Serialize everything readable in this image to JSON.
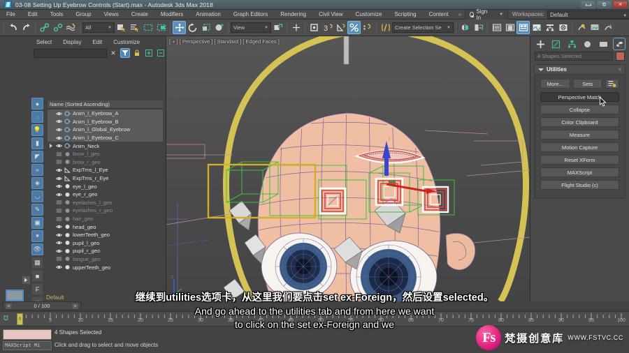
{
  "window": {
    "title": "03-08 Setting Up Eyebrow Controls (Start).max - Autodesk 3ds Max 2018",
    "app_icon": "3dsmax-icon",
    "buttons": {
      "minimize": "minimize-icon",
      "restore": "restore-icon",
      "close": "close-icon"
    }
  },
  "menubar": {
    "items": [
      "File",
      "Edit",
      "Tools",
      "Group",
      "Views",
      "Create",
      "Modifiers",
      "Animation",
      "Graph Editors",
      "Rendering",
      "Civil View",
      "Customize",
      "Scripting",
      "Content"
    ],
    "overflow": "»",
    "signin_label": "Sign In",
    "workspaces_label": "Workspaces:",
    "workspaces_value": "Default"
  },
  "toolbar": {
    "undo": "undo-icon",
    "redo": "redo-icon",
    "select_link": "select-and-link-icon",
    "unlink": "unlink-selection-icon",
    "bind_space_warp": "bind-to-space-warp-icon",
    "selection_filter": "All",
    "select_object": "select-object-icon",
    "select_by_name": "select-by-name-icon",
    "rect_select": "rectangular-selection-region-icon",
    "window_crossing": "window-crossing-icon",
    "select_move": "select-and-move-icon",
    "select_rotate": "select-and-rotate-icon",
    "select_scale": "select-and-scale-icon",
    "placement": "select-and-place-icon",
    "ref_coord_system": "View",
    "use_pivot": "use-pivot-point-center-icon",
    "select_manipulate": "select-and-manipulate-icon",
    "snaps_toggle_3": "snaps-toggle-icon",
    "angle_snap": "angle-snap-toggle-icon",
    "percent_snap": "percent-snap-toggle-icon",
    "spinner_snap": "spinner-snap-toggle-icon",
    "named_sel_edit": "edit-named-selection-sets-icon",
    "named_sel_value": "Create Selection Se",
    "mirror": "mirror-icon",
    "align": "align-icon",
    "layer_explorer": "layer-explorer-icon",
    "scene_explorer": "scene-explorer-icon",
    "ribbon_toggle": "toggle-ribbon-icon",
    "curve_editor": "curve-editor-icon",
    "schematic_view": "schematic-view-icon",
    "material_editor": "material-editor-icon",
    "render_setup": "render-setup-icon",
    "rendered_frame": "rendered-frame-window-icon",
    "render_production": "render-production-icon"
  },
  "explorer": {
    "menu": [
      "Select",
      "Display",
      "Edit",
      "Customize"
    ],
    "search_value": "",
    "tool_icons": [
      "clear-search-icon",
      "filter-icon",
      "lock-icon",
      "expand-all-icon",
      "collapse-all-icon"
    ],
    "column_header": "Name (Sorted Ascending)",
    "side_icons": [
      "geometry-icon",
      "shapes-icon",
      "lights-icon",
      "cameras-icon",
      "helpers-icon",
      "space-warps-icon",
      "particles-icon",
      "bones-icon",
      "ik-icon",
      "containers-icon",
      "groups-icon",
      "xrefs-icon",
      "frozen-icon",
      "hidden-icon",
      "layer-icon",
      "filter-by-name-icon",
      "filter-icon",
      "object-icon"
    ],
    "rows": [
      {
        "name": "Anim_l_Eyebrow_A",
        "selected": true,
        "dim": false,
        "type": "shape",
        "expandable": false
      },
      {
        "name": "Anim_l_Eyebrow_B",
        "selected": true,
        "dim": false,
        "type": "shape",
        "expandable": false
      },
      {
        "name": "Anim_l_Global_Eyebrow",
        "selected": true,
        "dim": false,
        "type": "shape",
        "expandable": false
      },
      {
        "name": "Anim_l_Eyebrow_C",
        "selected": true,
        "dim": false,
        "type": "shape",
        "expandable": false
      },
      {
        "name": "Anim_Neck",
        "selected": false,
        "dim": false,
        "type": "shape",
        "expandable": true
      },
      {
        "name": "brow_l_geo",
        "selected": false,
        "dim": true,
        "type": "geo-hidden",
        "expandable": false
      },
      {
        "name": "brow_r_geo",
        "selected": false,
        "dim": true,
        "type": "geo-hidden",
        "expandable": false
      },
      {
        "name": "ExpTrns_l_Eye",
        "selected": false,
        "dim": false,
        "type": "helper",
        "expandable": false
      },
      {
        "name": "ExpTrns_r_Eye",
        "selected": false,
        "dim": false,
        "type": "helper",
        "expandable": false
      },
      {
        "name": "eye_l_geo",
        "selected": false,
        "dim": false,
        "type": "geo",
        "expandable": false
      },
      {
        "name": "eye_r_geo",
        "selected": false,
        "dim": false,
        "type": "geo",
        "expandable": false
      },
      {
        "name": "eyelashes_l_geo",
        "selected": false,
        "dim": true,
        "type": "geo-hidden",
        "expandable": false
      },
      {
        "name": "eyelashes_r_geo",
        "selected": false,
        "dim": true,
        "type": "geo-hidden",
        "expandable": false
      },
      {
        "name": "hair_geo",
        "selected": false,
        "dim": true,
        "type": "geo-hidden",
        "expandable": false
      },
      {
        "name": "head_geo",
        "selected": false,
        "dim": false,
        "type": "geo",
        "expandable": false
      },
      {
        "name": "lowerTeeth_geo",
        "selected": false,
        "dim": false,
        "type": "geo",
        "expandable": false
      },
      {
        "name": "pupil_l_geo",
        "selected": false,
        "dim": false,
        "type": "geo",
        "expandable": false
      },
      {
        "name": "pupil_r_geo",
        "selected": false,
        "dim": false,
        "type": "geo",
        "expandable": false
      },
      {
        "name": "tongue_geo",
        "selected": false,
        "dim": true,
        "type": "geo-hidden",
        "expandable": false
      },
      {
        "name": "upperTeeth_geo",
        "selected": false,
        "dim": false,
        "type": "geo",
        "expandable": false
      }
    ],
    "hscroll_left": "◀",
    "hscroll_right": "▶",
    "layer_label": "Default"
  },
  "viewport": {
    "label": "[ + ] [ Perspective ] [ Standard ] [ Edged Faces ]",
    "axis_x": "x",
    "axis_y": "y",
    "axis_z": "z"
  },
  "command_panel": {
    "tabs": [
      {
        "name": "create-tab",
        "glyph": "➕"
      },
      {
        "name": "modify-tab",
        "glyph": "modify-icon"
      },
      {
        "name": "hierarchy-tab",
        "glyph": "hierarchy-icon"
      },
      {
        "name": "motion-tab",
        "glyph": "motion-icon"
      },
      {
        "name": "display-tab",
        "glyph": "display-icon"
      },
      {
        "name": "utilities-tab",
        "glyph": "wrench-icon",
        "active": true
      }
    ],
    "selection_name": "4 Shapes Selected",
    "color_swatch": "#c2635b",
    "rollout_title": "Utilities",
    "more_label": "More...",
    "sets_label": "Sets",
    "config_icon": "configure-button-sets-icon",
    "buttons": [
      {
        "label": "Perspective Match",
        "state": "hover"
      },
      {
        "label": "Collapse",
        "state": "normal"
      },
      {
        "label": "Color Clipboard",
        "state": "normal"
      },
      {
        "label": "Measure",
        "state": "normal"
      },
      {
        "label": "Motion Capture",
        "state": "normal"
      },
      {
        "label": "Reset XForm",
        "state": "normal"
      },
      {
        "label": "MAXScript",
        "state": "normal"
      },
      {
        "label": "Flight Studio (c)",
        "state": "normal"
      }
    ],
    "cursor": "mouse-pointer-icon"
  },
  "timebar": {
    "frame_field": "0 / 100",
    "prev_arrow": "<",
    "next_arrow": ">",
    "current_frame": "0",
    "tick_labels": [
      "5",
      "10",
      "15",
      "20",
      "25",
      "30",
      "35",
      "40",
      "45",
      "50",
      "55",
      "60",
      "65",
      "70",
      "75",
      "80",
      "85",
      "90",
      "95",
      "100"
    ],
    "key_mode_icon": "key-mode-toggle-icon"
  },
  "status": {
    "script_field": "MAXScript Mi",
    "selection_text": "4 Shapes Selected",
    "hint_text": "Click and drag to select and move objects"
  },
  "subtitles": {
    "chinese": "继续到utilities选项卡，从这里我们要点击set ex-Foreign，然后设置selected。",
    "english_line1": "And go ahead to the utilities tab and from here we want",
    "english_line2": "to click on the set ex-Foreign and we"
  },
  "watermark": {
    "logo_text": "Fs",
    "chinese": "梵摄创意库",
    "url": "WWW.FSTVC.CC"
  }
}
